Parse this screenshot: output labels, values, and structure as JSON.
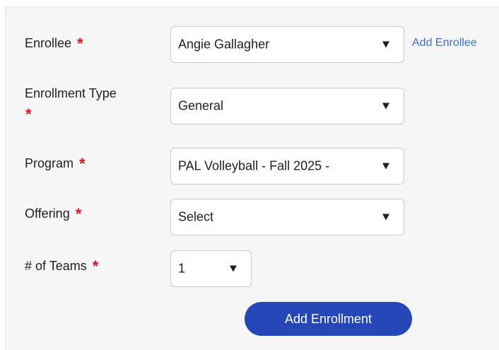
{
  "form": {
    "enrollee": {
      "label": "Enrollee",
      "required_mark": "*",
      "value": "Angie Gallagher",
      "add_link": "Add Enrollee"
    },
    "enrollment_type": {
      "label": "Enrollment Type",
      "required_mark": "*",
      "value": "General"
    },
    "program": {
      "label": "Program",
      "required_mark": "*",
      "value": "PAL Volleyball - Fall 2025 -"
    },
    "offering": {
      "label": "Offering",
      "required_mark": "*",
      "value": "Select"
    },
    "teams": {
      "label": "# of Teams",
      "required_mark": "*",
      "value": "1"
    },
    "submit_label": "Add Enrollment"
  },
  "colors": {
    "required": "#e3121b",
    "link": "#3a6fd8",
    "primary_button": "#2647b8",
    "panel_background": "#f6f6f6"
  }
}
